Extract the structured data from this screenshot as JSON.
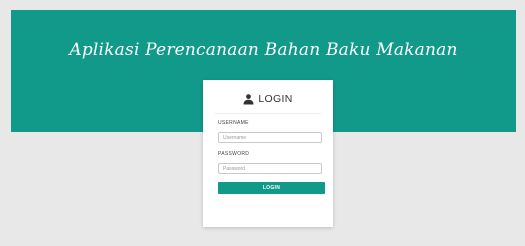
{
  "header": {
    "title": "Aplikasi Perencanaan Bahan Baku Makanan"
  },
  "login_card": {
    "title": "LOGIN",
    "title_icon": "user-icon",
    "username": {
      "label": "USERNAME",
      "placeholder": "Username",
      "value": ""
    },
    "password": {
      "label": "PASSWORD",
      "placeholder": "Password",
      "value": ""
    },
    "submit_label": "LOGIN"
  },
  "colors": {
    "brand": "#11998a",
    "background": "#e8e8e8",
    "card": "#ffffff"
  }
}
